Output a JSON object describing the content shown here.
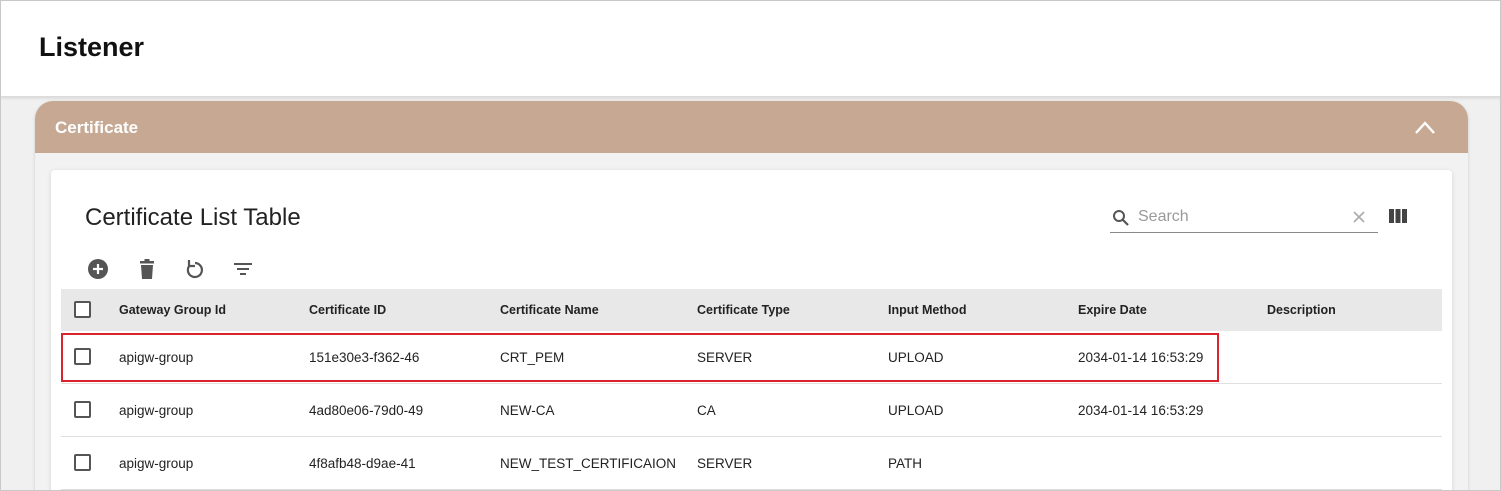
{
  "header": {
    "title": "Listener"
  },
  "panel": {
    "title": "Certificate",
    "collapse_icon": "chevron-up-icon"
  },
  "card": {
    "title": "Certificate List Table",
    "search": {
      "placeholder": "Search",
      "value": ""
    },
    "toolbar": [
      "add-circle-icon",
      "delete-icon",
      "refresh-icon",
      "filter-icon"
    ]
  },
  "table": {
    "columns": [
      "Gateway Group Id",
      "Certificate ID",
      "Certificate Name",
      "Certificate Type",
      "Input Method",
      "Expire Date",
      "Description"
    ],
    "rows": [
      [
        "apigw-group",
        "151e30e3-f362-46",
        "CRT_PEM",
        "SERVER",
        "UPLOAD",
        "2034-01-14 16:53:29",
        ""
      ],
      [
        "apigw-group",
        "4ad80e06-79d0-49",
        "NEW-CA",
        "CA",
        "UPLOAD",
        "2034-01-14 16:53:29",
        ""
      ],
      [
        "apigw-group",
        "4f8afb48-d9ae-41",
        "NEW_TEST_CERTIFICAION",
        "SERVER",
        "PATH",
        "",
        ""
      ]
    ]
  },
  "colors": {
    "panel_header": "#c7a993",
    "highlight": "#d9232d"
  }
}
